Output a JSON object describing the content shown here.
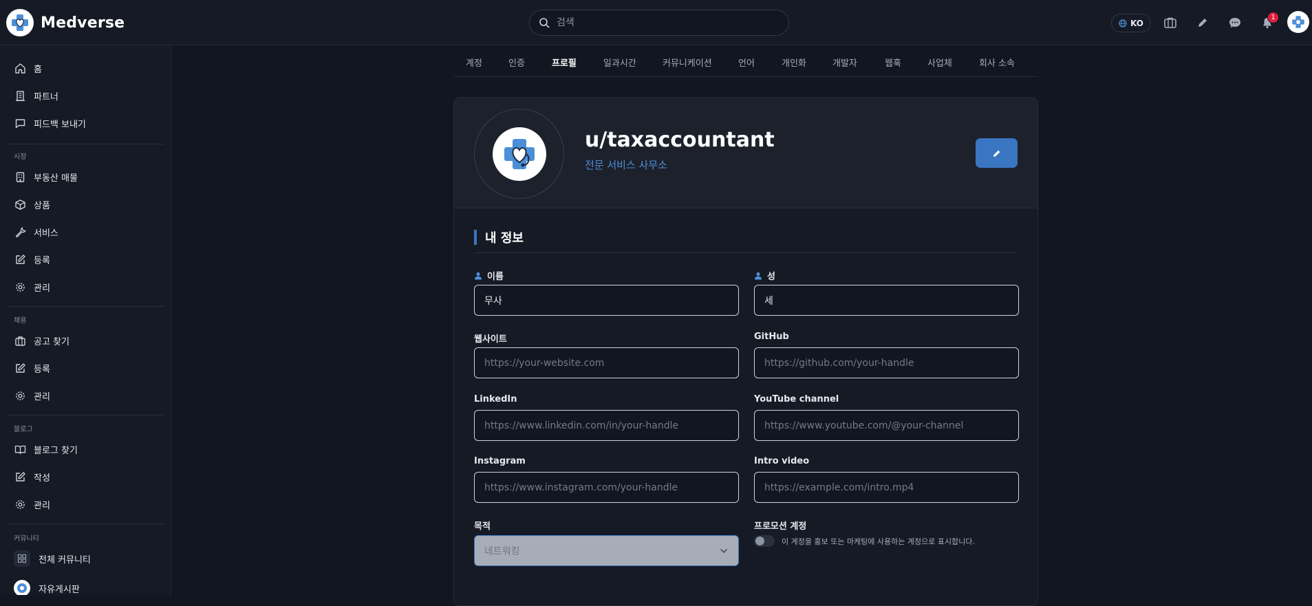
{
  "app": {
    "name": "Medverse"
  },
  "search": {
    "placeholder": "검색"
  },
  "language": {
    "code": "KO"
  },
  "notifications": {
    "count": "1"
  },
  "sidebar": {
    "top_items": [
      {
        "label": "홈",
        "icon": "home-icon"
      },
      {
        "label": "파트너",
        "icon": "building-icon"
      },
      {
        "label": "피드백 보내기",
        "icon": "message-icon"
      }
    ],
    "sections": [
      {
        "title": "시장",
        "items": [
          {
            "label": "부동산 매물",
            "icon": "building-icon"
          },
          {
            "label": "상품",
            "icon": "box-icon"
          },
          {
            "label": "서비스",
            "icon": "wrench-icon"
          },
          {
            "label": "등록",
            "icon": "edit-icon"
          },
          {
            "label": "관리",
            "icon": "gear-icon"
          }
        ]
      },
      {
        "title": "채용",
        "items": [
          {
            "label": "공고 찾기",
            "icon": "briefcase-icon"
          },
          {
            "label": "등록",
            "icon": "edit-icon"
          },
          {
            "label": "관리",
            "icon": "gear-icon"
          }
        ]
      },
      {
        "title": "블로그",
        "items": [
          {
            "label": "블로그 찾기",
            "icon": "book-icon"
          },
          {
            "label": "작성",
            "icon": "edit-icon"
          },
          {
            "label": "관리",
            "icon": "gear-icon"
          }
        ]
      },
      {
        "title": "커뮤니티",
        "items": [
          {
            "label": "전체 커뮤니티",
            "icon": "grid-icon"
          },
          {
            "label": "자유게시판",
            "icon": "avatar"
          }
        ]
      }
    ]
  },
  "tabs": [
    "계정",
    "인증",
    "프로필",
    "일과시간",
    "커뮤니케이션",
    "언어",
    "개인화",
    "개발자",
    "웹훅",
    "사업체",
    "회사 소속"
  ],
  "active_tab": "프로필",
  "profile": {
    "username": "u/taxaccountant",
    "organization": "전문 서비스 사무소"
  },
  "section_title": "내 정보",
  "fields": {
    "first_name": {
      "label": "이름",
      "value": "무사"
    },
    "last_name": {
      "label": "성",
      "value": "세"
    },
    "website": {
      "label": "웹사이트",
      "placeholder": "https://your-website.com"
    },
    "github": {
      "label": "GitHub",
      "placeholder": "https://github.com/your-handle"
    },
    "linkedin": {
      "label": "LinkedIn",
      "placeholder": "https://www.linkedin.com/in/your-handle"
    },
    "youtube": {
      "label": "YouTube channel",
      "placeholder": "https://www.youtube.com/@your-channel"
    },
    "instagram": {
      "label": "Instagram",
      "placeholder": "https://www.instagram.com/your-handle"
    },
    "intro_video": {
      "label": "Intro video",
      "placeholder": "https://example.com/intro.mp4"
    },
    "purpose": {
      "label": "목적",
      "value": "네트워킹"
    },
    "promotion": {
      "label": "프로모션 계정",
      "description": "이 계정을 홍보 또는 마케팅에 사용하는 계정으로 표시합니다.",
      "enabled": false
    }
  },
  "colors": {
    "accent": "#3a75c2",
    "link": "#4f8ed8",
    "background": "#111620",
    "panel": "#151a24",
    "badge": "#e11d3f"
  }
}
